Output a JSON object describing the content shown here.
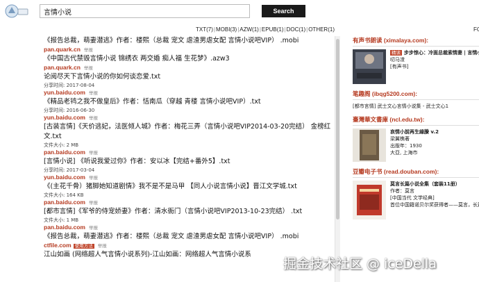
{
  "search": {
    "query": "言情小说",
    "button": "Search"
  },
  "filters": [
    "TXT(7)",
    "MOBI(3)",
    "AZW(1)",
    "EPUB(1)",
    "DOC(1)",
    "OTHER(1)"
  ],
  "fo_label": "FO",
  "results": [
    {
      "title": "《报告总裁，萌妻潜逃》作者：楼熙（总裁 宠文 虐渣男虐女配 言情小说吧VIP） .mobi",
      "source": "pan.quark.cn",
      "report": "举报"
    },
    {
      "title": "《中国古代禁毁言情小说 锦绣衣 两交婚 痴人福 生花梦》.azw3",
      "source": "pan.quark.cn",
      "report": "举报"
    },
    {
      "title": "论阅尽天下言情小说的你如何谈恋爱.txt",
      "meta": [
        "分享时间: 2017-08-04"
      ],
      "source": "yun.baidu.com",
      "report": "举报"
    },
    {
      "title": "《精品老鸨之我不做皇后》作者：恬南瓜（穿越 青楼 言情小说吧VIP）.txt",
      "meta": [
        "分享时间: 2016-06-30"
      ],
      "source": "yun.baidu.com",
      "report": "举报"
    },
    {
      "title": "[古装言情]《天价逃妃，法医倾人城》作者：梅花三弄（言情小说吧VIP2014-03-20完结） 金榜红文.txt",
      "meta": [
        "文件大小: 2 MB"
      ],
      "source": "pan.baidu.com",
      "report": "举报"
    },
    {
      "title": "[言情小说] 《听说我爱过你》作者：安以冰【完结+番外5】.txt",
      "meta": [
        "分享时间: 2017-03-04"
      ],
      "source": "yun.baidu.com",
      "report": "举报"
    },
    {
      "title": "《(主花千骨）猪脚她知道剧情》我不是不是马甲 【同人小说言情小说】晋江文学城.txt",
      "meta": [
        "文件大小: 164 KB"
      ],
      "source": "pan.baidu.com",
      "report": "举报"
    },
    {
      "title": "[都市言情]《军爷的侍宠娇妻》作者：清水衙门（言情小说吧VIP2013-10-23完结） .txt",
      "meta": [
        "文件大小: 1 MB"
      ],
      "source": "pan.baidu.com",
      "report": "举报"
    },
    {
      "title": "《报告总裁，萌妻潜逃》作者：楼熙（总裁 宠文 虐渣男虐女配 言情小说吧VIP） .mobi",
      "source": "ctfile.com",
      "tag": "使用方法",
      "report": "举报"
    },
    {
      "title": "江山如画 (网络超人气言情小说系列)-江山如画：网络超人气言情小说系",
      "source": "",
      "report": ""
    }
  ],
  "side": {
    "ximalaya": {
      "head": "有声书朗读 (ximalaya.com):",
      "tag": "精读",
      "title": "步步惊心：冷面总裁索情妻 | 言情小",
      "reader": "叨马渣",
      "kind": "[有声书]",
      "cover_text": "冷面总裁索情妻"
    },
    "ibqg": {
      "head": "笔趣阁 (ibqg5200.com):",
      "text": "[都市言情] 武士文心言情小说集 - 武士文心1"
    },
    "ncl": {
      "head": "臺灣華文書庫 (ncl.edu.tw):",
      "title": "哀情小說再生緣賸 v.2",
      "author": "梁翼樵著",
      "year": "出版年：1930",
      "place": "大亞, 上海市"
    },
    "douban": {
      "head": "豆瓣电子书 (read.douban.com):",
      "title": "莫言长篇小说全集（套装11册）",
      "author": "作者：莫言",
      "category": "[中国当代 文学经典]",
      "desc": "首位中国籍诺贝尔奖获得者——莫言，长篇"
    }
  },
  "watermark": "掘金技术社区 @ iceDella",
  "colors": {
    "accent": "#b5391f",
    "button": "#1a1a1a"
  }
}
